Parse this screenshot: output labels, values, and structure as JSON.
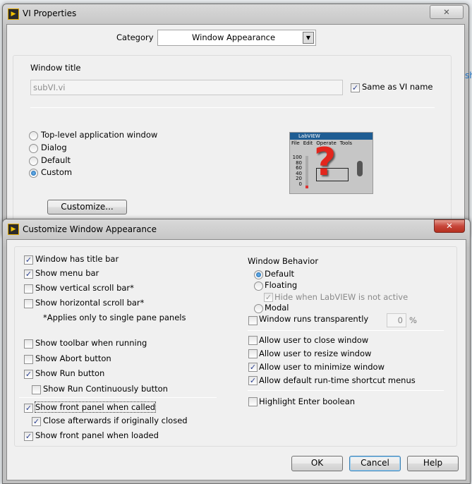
{
  "vi_properties": {
    "title": "VI Properties",
    "category_label": "Category",
    "category_value": "Window Appearance",
    "window_title_label": "Window title",
    "window_title_value": "subVI.vi",
    "same_as_vi_name": {
      "label": "Same as VI name",
      "checked": true
    },
    "window_types": [
      {
        "label": "Top-level application window",
        "selected": false
      },
      {
        "label": "Dialog",
        "selected": false
      },
      {
        "label": "Default",
        "selected": false
      },
      {
        "label": "Custom",
        "selected": true
      }
    ],
    "customize_button": "Customize...",
    "preview": {
      "title": "LabVIEW",
      "menus": [
        "File",
        "Edit",
        "Operate",
        "Tools"
      ],
      "scale": [
        "100",
        "80",
        "60",
        "40",
        "20",
        "0"
      ]
    }
  },
  "customize": {
    "title": "Customize Window Appearance",
    "left": [
      {
        "label": "Window has title bar",
        "checked": true
      },
      {
        "label": "Show menu bar",
        "checked": true
      },
      {
        "label": "Show vertical scroll bar*",
        "checked": false
      },
      {
        "label": "Show horizontal scroll bar*",
        "checked": false
      }
    ],
    "note": "*Applies only to single pane panels",
    "left2": [
      {
        "label": "Show toolbar when running",
        "checked": false
      },
      {
        "label": "Show Abort button",
        "checked": false
      },
      {
        "label": "Show Run button",
        "checked": true
      },
      {
        "label": "Show Run Continuously button",
        "checked": false
      }
    ],
    "left3": [
      {
        "label": "Show front panel when called",
        "checked": true
      },
      {
        "label": "Close afterwards if originally closed",
        "checked": true
      },
      {
        "label": "Show front panel when loaded",
        "checked": true
      }
    ],
    "behavior_label": "Window Behavior",
    "behavior": [
      {
        "label": "Default",
        "selected": true
      },
      {
        "label": "Floating",
        "selected": false
      },
      {
        "label": "Modal",
        "selected": false
      }
    ],
    "hide_when_inactive": {
      "label": "Hide when LabVIEW is not active",
      "checked": true,
      "disabled": true
    },
    "transparent": {
      "label": "Window runs transparently",
      "checked": false
    },
    "transparency_value": "0",
    "transparency_unit": "%",
    "right2": [
      {
        "label": "Allow user to close window",
        "checked": false
      },
      {
        "label": "Allow user to resize window",
        "checked": false
      },
      {
        "label": "Allow user to minimize window",
        "checked": true
      },
      {
        "label": "Allow default run-time shortcut menus",
        "checked": true
      }
    ],
    "highlight_enter": {
      "label": "Highlight Enter boolean",
      "checked": false
    },
    "buttons": {
      "ok": "OK",
      "cancel": "Cancel",
      "help": "Help"
    }
  },
  "colors": {
    "close_red": "#c7463a",
    "focus_blue": "#3c7fb1"
  }
}
